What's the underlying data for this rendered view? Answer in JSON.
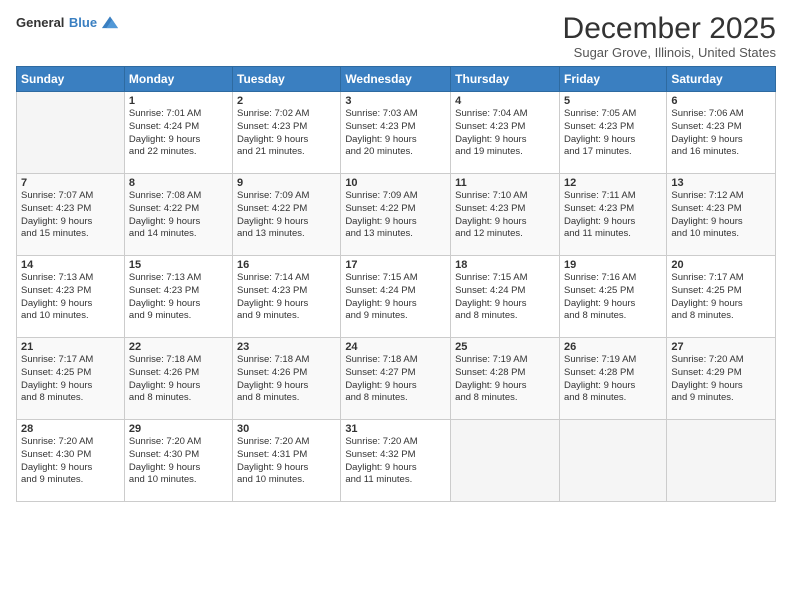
{
  "logo": {
    "line1": "General",
    "line2": "Blue"
  },
  "header": {
    "title": "December 2025",
    "location": "Sugar Grove, Illinois, United States"
  },
  "weekdays": [
    "Sunday",
    "Monday",
    "Tuesday",
    "Wednesday",
    "Thursday",
    "Friday",
    "Saturday"
  ],
  "weeks": [
    [
      {
        "day": "",
        "info": ""
      },
      {
        "day": "1",
        "info": "Sunrise: 7:01 AM\nSunset: 4:24 PM\nDaylight: 9 hours\nand 22 minutes."
      },
      {
        "day": "2",
        "info": "Sunrise: 7:02 AM\nSunset: 4:23 PM\nDaylight: 9 hours\nand 21 minutes."
      },
      {
        "day": "3",
        "info": "Sunrise: 7:03 AM\nSunset: 4:23 PM\nDaylight: 9 hours\nand 20 minutes."
      },
      {
        "day": "4",
        "info": "Sunrise: 7:04 AM\nSunset: 4:23 PM\nDaylight: 9 hours\nand 19 minutes."
      },
      {
        "day": "5",
        "info": "Sunrise: 7:05 AM\nSunset: 4:23 PM\nDaylight: 9 hours\nand 17 minutes."
      },
      {
        "day": "6",
        "info": "Sunrise: 7:06 AM\nSunset: 4:23 PM\nDaylight: 9 hours\nand 16 minutes."
      }
    ],
    [
      {
        "day": "7",
        "info": "Sunrise: 7:07 AM\nSunset: 4:23 PM\nDaylight: 9 hours\nand 15 minutes."
      },
      {
        "day": "8",
        "info": "Sunrise: 7:08 AM\nSunset: 4:22 PM\nDaylight: 9 hours\nand 14 minutes."
      },
      {
        "day": "9",
        "info": "Sunrise: 7:09 AM\nSunset: 4:22 PM\nDaylight: 9 hours\nand 13 minutes."
      },
      {
        "day": "10",
        "info": "Sunrise: 7:09 AM\nSunset: 4:22 PM\nDaylight: 9 hours\nand 13 minutes."
      },
      {
        "day": "11",
        "info": "Sunrise: 7:10 AM\nSunset: 4:23 PM\nDaylight: 9 hours\nand 12 minutes."
      },
      {
        "day": "12",
        "info": "Sunrise: 7:11 AM\nSunset: 4:23 PM\nDaylight: 9 hours\nand 11 minutes."
      },
      {
        "day": "13",
        "info": "Sunrise: 7:12 AM\nSunset: 4:23 PM\nDaylight: 9 hours\nand 10 minutes."
      }
    ],
    [
      {
        "day": "14",
        "info": "Sunrise: 7:13 AM\nSunset: 4:23 PM\nDaylight: 9 hours\nand 10 minutes."
      },
      {
        "day": "15",
        "info": "Sunrise: 7:13 AM\nSunset: 4:23 PM\nDaylight: 9 hours\nand 9 minutes."
      },
      {
        "day": "16",
        "info": "Sunrise: 7:14 AM\nSunset: 4:23 PM\nDaylight: 9 hours\nand 9 minutes."
      },
      {
        "day": "17",
        "info": "Sunrise: 7:15 AM\nSunset: 4:24 PM\nDaylight: 9 hours\nand 9 minutes."
      },
      {
        "day": "18",
        "info": "Sunrise: 7:15 AM\nSunset: 4:24 PM\nDaylight: 9 hours\nand 8 minutes."
      },
      {
        "day": "19",
        "info": "Sunrise: 7:16 AM\nSunset: 4:25 PM\nDaylight: 9 hours\nand 8 minutes."
      },
      {
        "day": "20",
        "info": "Sunrise: 7:17 AM\nSunset: 4:25 PM\nDaylight: 9 hours\nand 8 minutes."
      }
    ],
    [
      {
        "day": "21",
        "info": "Sunrise: 7:17 AM\nSunset: 4:25 PM\nDaylight: 9 hours\nand 8 minutes."
      },
      {
        "day": "22",
        "info": "Sunrise: 7:18 AM\nSunset: 4:26 PM\nDaylight: 9 hours\nand 8 minutes."
      },
      {
        "day": "23",
        "info": "Sunrise: 7:18 AM\nSunset: 4:26 PM\nDaylight: 9 hours\nand 8 minutes."
      },
      {
        "day": "24",
        "info": "Sunrise: 7:18 AM\nSunset: 4:27 PM\nDaylight: 9 hours\nand 8 minutes."
      },
      {
        "day": "25",
        "info": "Sunrise: 7:19 AM\nSunset: 4:28 PM\nDaylight: 9 hours\nand 8 minutes."
      },
      {
        "day": "26",
        "info": "Sunrise: 7:19 AM\nSunset: 4:28 PM\nDaylight: 9 hours\nand 8 minutes."
      },
      {
        "day": "27",
        "info": "Sunrise: 7:20 AM\nSunset: 4:29 PM\nDaylight: 9 hours\nand 9 minutes."
      }
    ],
    [
      {
        "day": "28",
        "info": "Sunrise: 7:20 AM\nSunset: 4:30 PM\nDaylight: 9 hours\nand 9 minutes."
      },
      {
        "day": "29",
        "info": "Sunrise: 7:20 AM\nSunset: 4:30 PM\nDaylight: 9 hours\nand 10 minutes."
      },
      {
        "day": "30",
        "info": "Sunrise: 7:20 AM\nSunset: 4:31 PM\nDaylight: 9 hours\nand 10 minutes."
      },
      {
        "day": "31",
        "info": "Sunrise: 7:20 AM\nSunset: 4:32 PM\nDaylight: 9 hours\nand 11 minutes."
      },
      {
        "day": "",
        "info": ""
      },
      {
        "day": "",
        "info": ""
      },
      {
        "day": "",
        "info": ""
      }
    ]
  ]
}
